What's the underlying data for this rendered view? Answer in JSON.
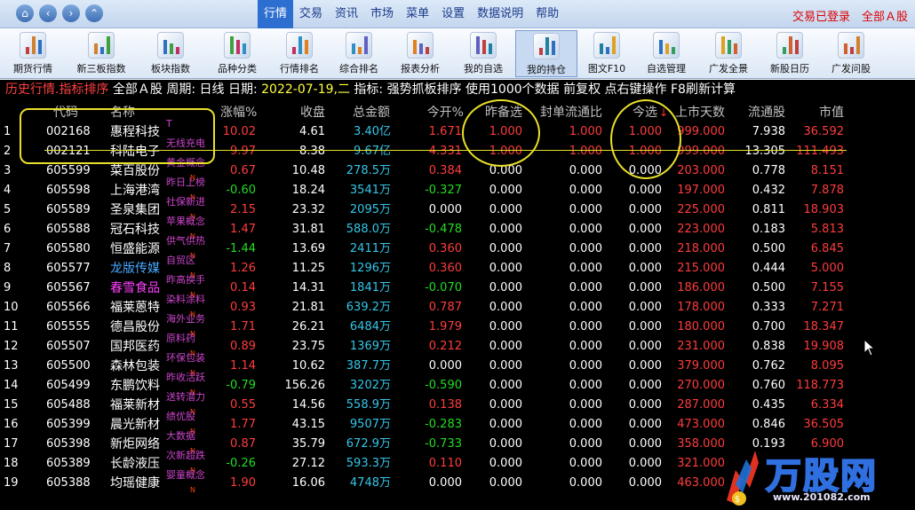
{
  "menu": {
    "items": [
      "行情",
      "交易",
      "资讯",
      "市场",
      "菜单",
      "设置",
      "数据说明",
      "帮助"
    ],
    "active": "行情",
    "trade_status": "交易已登录",
    "market_filter": "全部Ａ股"
  },
  "toolbar": {
    "items": [
      "期货行情",
      "新三板指数",
      "板块指数",
      "品种分类",
      "行情排名",
      "综合排名",
      "报表分析",
      "我的自选",
      "我的持仓",
      "图文F10",
      "自选管理",
      "广发全景",
      "新股日历",
      "广发问股"
    ],
    "selected": "我的持仓"
  },
  "infobar": {
    "history": "历史行情.指标排序",
    "segment2": " 全部Ａ股 周期: 日线 日期: ",
    "date": "2022-07-19,二",
    "segment4": " 指标: 强势抓板排序 使用1000个数据 前复权 点右键操作 F8刷新计算"
  },
  "table": {
    "headers": [
      "代码",
      "名称",
      "涨幅%",
      "收盘",
      "总金额",
      "今开%",
      "昨备选",
      "封单流通比",
      "今选",
      "上市天数",
      "流通股",
      "市值"
    ],
    "sort_arrow": "↓",
    "rows": [
      {
        "idx": "1",
        "code": "002168",
        "name": "惠程科技",
        "tag": "T",
        "chg": "10.02",
        "close": "4.61",
        "amt": "3.40亿",
        "open": "1.671",
        "yest": "1.000",
        "seal": "1.000",
        "today": "1.000",
        "days": "999.000",
        "float": "7.938",
        "mcap": "36.592",
        "dir": "up",
        "namecolor": "#ffffff"
      },
      {
        "idx": "2",
        "code": "002121",
        "name": "科陆电子",
        "tag": "无线充电",
        "chg": "9.97",
        "close": "8.38",
        "amt": "9.67亿",
        "open": "4.331",
        "yest": "1.000",
        "seal": "1.000",
        "today": "1.000",
        "days": "999.000",
        "float": "13.305",
        "mcap": "111.493",
        "dir": "up",
        "namecolor": "#ffffff"
      },
      {
        "idx": "3",
        "code": "605599",
        "name": "菜百股份",
        "tag": "黄金概念",
        "chg": "0.67",
        "close": "10.48",
        "amt": "278.5万",
        "open": "0.384",
        "yest": "0.000",
        "seal": "0.000",
        "today": "0.000",
        "days": "203.000",
        "float": "0.778",
        "mcap": "8.151",
        "dir": "up",
        "namecolor": "#ffffff"
      },
      {
        "idx": "4",
        "code": "605598",
        "name": "上海港湾",
        "tag": "昨日上榜",
        "chg": "-0.60",
        "close": "18.24",
        "amt": "3541万",
        "open": "-0.327",
        "yest": "0.000",
        "seal": "0.000",
        "today": "0.000",
        "days": "197.000",
        "float": "0.432",
        "mcap": "7.878",
        "dir": "down",
        "namecolor": "#ffffff"
      },
      {
        "idx": "5",
        "code": "605589",
        "name": "圣泉集团",
        "tag": "社保新进",
        "chg": "2.15",
        "close": "23.32",
        "amt": "2095万",
        "open": "0.000",
        "yest": "0.000",
        "seal": "0.000",
        "today": "0.000",
        "days": "225.000",
        "float": "0.811",
        "mcap": "18.903",
        "dir": "up",
        "namecolor": "#ffffff"
      },
      {
        "idx": "6",
        "code": "605588",
        "name": "冠石科技",
        "tag": "苹果概念",
        "chg": "1.47",
        "close": "31.81",
        "amt": "588.0万",
        "open": "-0.478",
        "yest": "0.000",
        "seal": "0.000",
        "today": "0.000",
        "days": "223.000",
        "float": "0.183",
        "mcap": "5.813",
        "dir": "up",
        "namecolor": "#ffffff"
      },
      {
        "idx": "7",
        "code": "605580",
        "name": "恒盛能源",
        "tag": "供气供热",
        "chg": "-1.44",
        "close": "13.69",
        "amt": "2411万",
        "open": "0.360",
        "yest": "0.000",
        "seal": "0.000",
        "today": "0.000",
        "days": "218.000",
        "float": "0.500",
        "mcap": "6.845",
        "dir": "down",
        "namecolor": "#ffffff"
      },
      {
        "idx": "8",
        "code": "605577",
        "name": "龙版传媒",
        "tag": "自贸区",
        "chg": "1.26",
        "close": "11.25",
        "amt": "1296万",
        "open": "0.360",
        "yest": "0.000",
        "seal": "0.000",
        "today": "0.000",
        "days": "215.000",
        "float": "0.444",
        "mcap": "5.000",
        "dir": "up",
        "namecolor": "#4aa8ff"
      },
      {
        "idx": "9",
        "code": "605567",
        "name": "春雪食品",
        "tag": "昨高换手",
        "chg": "0.14",
        "close": "14.31",
        "amt": "1841万",
        "open": "-0.070",
        "yest": "0.000",
        "seal": "0.000",
        "today": "0.000",
        "days": "186.000",
        "float": "0.500",
        "mcap": "7.155",
        "dir": "up",
        "namecolor": "#ff40ff"
      },
      {
        "idx": "10",
        "code": "605566",
        "name": "福莱蒽特",
        "tag": "染料涂料",
        "chg": "0.93",
        "close": "21.81",
        "amt": "639.2万",
        "open": "0.787",
        "yest": "0.000",
        "seal": "0.000",
        "today": "0.000",
        "days": "178.000",
        "float": "0.333",
        "mcap": "7.271",
        "dir": "up",
        "namecolor": "#ffffff"
      },
      {
        "idx": "11",
        "code": "605555",
        "name": "德昌股份",
        "tag": "海外业务",
        "chg": "1.71",
        "close": "26.21",
        "amt": "6484万",
        "open": "1.979",
        "yest": "0.000",
        "seal": "0.000",
        "today": "0.000",
        "days": "180.000",
        "float": "0.700",
        "mcap": "18.347",
        "dir": "up",
        "namecolor": "#ffffff"
      },
      {
        "idx": "12",
        "code": "605507",
        "name": "国邦医药",
        "tag": "原料药",
        "chg": "0.89",
        "close": "23.75",
        "amt": "1369万",
        "open": "0.212",
        "yest": "0.000",
        "seal": "0.000",
        "today": "0.000",
        "days": "231.000",
        "float": "0.838",
        "mcap": "19.908",
        "dir": "up",
        "namecolor": "#ffffff"
      },
      {
        "idx": "13",
        "code": "605500",
        "name": "森林包装",
        "tag": "环保包装",
        "chg": "1.14",
        "close": "10.62",
        "amt": "387.7万",
        "open": "0.000",
        "yest": "0.000",
        "seal": "0.000",
        "today": "0.000",
        "days": "379.000",
        "float": "0.762",
        "mcap": "8.095",
        "dir": "up",
        "namecolor": "#ffffff"
      },
      {
        "idx": "14",
        "code": "605499",
        "name": "东鹏饮料",
        "tag": "昨收活跃",
        "chg": "-0.79",
        "close": "156.26",
        "amt": "3202万",
        "open": "-0.590",
        "yest": "0.000",
        "seal": "0.000",
        "today": "0.000",
        "days": "270.000",
        "float": "0.760",
        "mcap": "118.773",
        "dir": "down",
        "namecolor": "#ffffff"
      },
      {
        "idx": "15",
        "code": "605488",
        "name": "福莱新材",
        "tag": "送转潜力",
        "chg": "0.55",
        "close": "14.56",
        "amt": "558.9万",
        "open": "0.138",
        "yest": "0.000",
        "seal": "0.000",
        "today": "0.000",
        "days": "287.000",
        "float": "0.435",
        "mcap": "6.334",
        "dir": "up",
        "namecolor": "#ffffff"
      },
      {
        "idx": "16",
        "code": "605399",
        "name": "晨光新材",
        "tag": "绩优股",
        "chg": "1.77",
        "close": "43.15",
        "amt": "9507万",
        "open": "-0.283",
        "yest": "0.000",
        "seal": "0.000",
        "today": "0.000",
        "days": "473.000",
        "float": "0.846",
        "mcap": "36.505",
        "dir": "up",
        "namecolor": "#ffffff"
      },
      {
        "idx": "17",
        "code": "605398",
        "name": "新炬网络",
        "tag": "大数据",
        "chg": "0.87",
        "close": "35.79",
        "amt": "672.9万",
        "open": "-0.733",
        "yest": "0.000",
        "seal": "0.000",
        "today": "0.000",
        "days": "358.000",
        "float": "0.193",
        "mcap": "6.900",
        "dir": "up",
        "namecolor": "#ffffff"
      },
      {
        "idx": "18",
        "code": "605389",
        "name": "长龄液压",
        "tag": "次新超跌",
        "chg": "-0.26",
        "close": "27.12",
        "amt": "593.3万",
        "open": "0.110",
        "yest": "0.000",
        "seal": "0.000",
        "today": "0.000",
        "days": "321.000",
        "float": "",
        "mcap": "",
        "dir": "down",
        "namecolor": "#ffffff"
      },
      {
        "idx": "19",
        "code": "605388",
        "name": "均瑶健康",
        "tag": "婴童概念",
        "chg": "1.90",
        "close": "16.06",
        "amt": "4748万",
        "open": "0.000",
        "yest": "0.000",
        "seal": "0.000",
        "today": "0.000",
        "days": "463.000",
        "float": "",
        "mcap": "",
        "dir": "up",
        "namecolor": "#ffffff"
      }
    ]
  },
  "watermark": {
    "text": "万股网",
    "url": "www.201082.com"
  },
  "colors": {
    "up": "#ff3c3c",
    "down": "#22dd22",
    "highlight": "#e8e02a",
    "code": "#ffffff",
    "amount": "#35c6e8",
    "header": "#c0c0c0"
  }
}
